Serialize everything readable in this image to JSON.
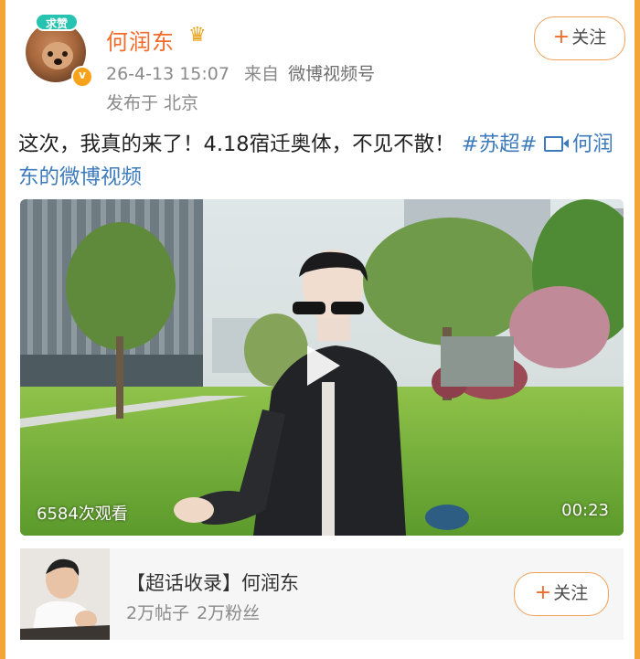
{
  "user": {
    "badge": "求赞",
    "name": "何润东",
    "verified_mark": "v",
    "time": "26-4-13 15:07",
    "source_prefix": "来自",
    "source": "微博视频号",
    "location": "发布于 北京",
    "follow_label": "关注"
  },
  "post": {
    "text": "这次，我真的来了！4.18宿迁奥体，不见不散！",
    "hashtag": "#苏超#",
    "video_link": "何润东的微博视频"
  },
  "video": {
    "views": "6584次观看",
    "duration": "00:23"
  },
  "topic": {
    "title": "【超话收录】何润东",
    "posts": "2万帖子",
    "fans": "2万粉丝",
    "follow_label": "关注"
  },
  "colors": {
    "background": "#f3a637",
    "name": "#f26b2a",
    "link": "#3d7bbd"
  }
}
